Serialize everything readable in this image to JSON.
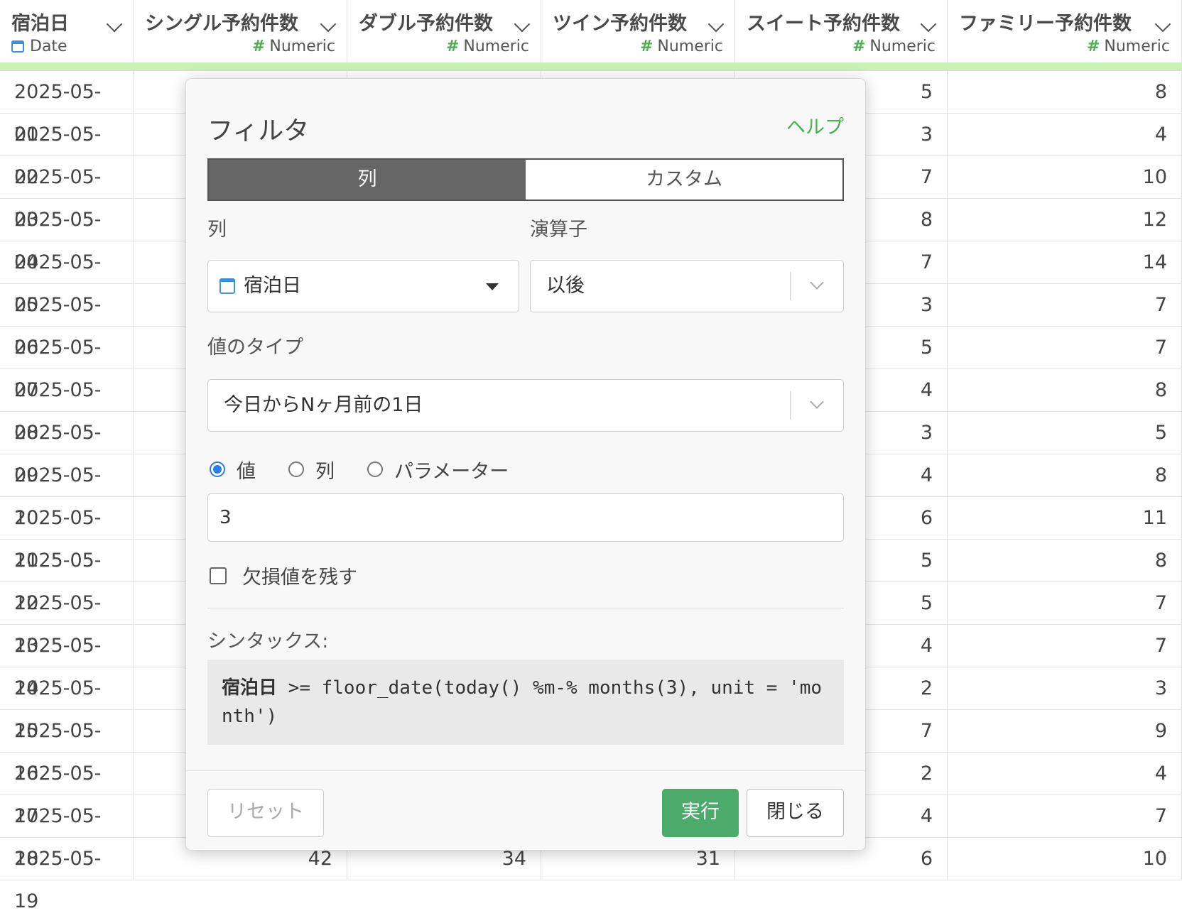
{
  "columns": [
    {
      "name": "宿泊日",
      "type": "Date",
      "type_icon": "calendar-icon"
    },
    {
      "name": "シングル予約件数",
      "type": "Numeric",
      "type_icon": "#"
    },
    {
      "name": "ダブル予約件数",
      "type": "Numeric",
      "type_icon": "#"
    },
    {
      "name": "ツイン予約件数",
      "type": "Numeric",
      "type_icon": "#"
    },
    {
      "name": "スイート予約件数",
      "type": "Numeric",
      "type_icon": "#"
    },
    {
      "name": "ファミリー予約件数",
      "type": "Numeric",
      "type_icon": "#"
    }
  ],
  "rows": [
    {
      "date": "2025-05-01",
      "single": "",
      "double": "",
      "twin": "",
      "suite": "5",
      "family": "8"
    },
    {
      "date": "2025-05-02",
      "single": "",
      "double": "",
      "twin": "",
      "suite": "3",
      "family": "4"
    },
    {
      "date": "2025-05-03",
      "single": "",
      "double": "",
      "twin": "",
      "suite": "7",
      "family": "10"
    },
    {
      "date": "2025-05-04",
      "single": "",
      "double": "",
      "twin": "",
      "suite": "8",
      "family": "12"
    },
    {
      "date": "2025-05-05",
      "single": "",
      "double": "",
      "twin": "",
      "suite": "7",
      "family": "14"
    },
    {
      "date": "2025-05-06",
      "single": "",
      "double": "",
      "twin": "",
      "suite": "3",
      "family": "7"
    },
    {
      "date": "2025-05-07",
      "single": "",
      "double": "",
      "twin": "",
      "suite": "5",
      "family": "7"
    },
    {
      "date": "2025-05-08",
      "single": "",
      "double": "",
      "twin": "",
      "suite": "4",
      "family": "8"
    },
    {
      "date": "2025-05-09",
      "single": "",
      "double": "",
      "twin": "",
      "suite": "3",
      "family": "5"
    },
    {
      "date": "2025-05-10",
      "single": "",
      "double": "",
      "twin": "",
      "suite": "4",
      "family": "8"
    },
    {
      "date": "2025-05-11",
      "single": "",
      "double": "",
      "twin": "",
      "suite": "6",
      "family": "11"
    },
    {
      "date": "2025-05-12",
      "single": "",
      "double": "",
      "twin": "",
      "suite": "5",
      "family": "8"
    },
    {
      "date": "2025-05-13",
      "single": "",
      "double": "",
      "twin": "",
      "suite": "5",
      "family": "7"
    },
    {
      "date": "2025-05-14",
      "single": "",
      "double": "",
      "twin": "",
      "suite": "4",
      "family": "7"
    },
    {
      "date": "2025-05-15",
      "single": "",
      "double": "",
      "twin": "",
      "suite": "2",
      "family": "3"
    },
    {
      "date": "2025-05-16",
      "single": "",
      "double": "",
      "twin": "",
      "suite": "7",
      "family": "9"
    },
    {
      "date": "2025-05-17",
      "single": "",
      "double": "",
      "twin": "",
      "suite": "2",
      "family": "4"
    },
    {
      "date": "2025-05-18",
      "single": "",
      "double": "",
      "twin": "",
      "suite": "4",
      "family": "7"
    },
    {
      "date": "2025-05-19",
      "single": "42",
      "double": "34",
      "twin": "31",
      "suite": "6",
      "family": "10"
    }
  ],
  "filter": {
    "title": "フィルタ",
    "help": "ヘルプ",
    "tabs": {
      "column": "列",
      "custom": "カスタム"
    },
    "column_label": "列",
    "column_value": "宿泊日",
    "operator_label": "演算子",
    "operator_value": "以後",
    "value_type_label": "値のタイプ",
    "value_type_value": "今日からNヶ月前の1日",
    "radio": {
      "value": "値",
      "column": "列",
      "parameter": "パラメーター",
      "selected": "value"
    },
    "input_value": "3",
    "keep_na_label": "欠損値を残す",
    "syntax_label": "シンタックス:",
    "syntax_column": "宿泊日",
    "syntax_expr": " >= floor_date(today() %m-% months(3), unit = 'month')",
    "buttons": {
      "reset": "リセット",
      "run": "実行",
      "close": "閉じる"
    },
    "accent_color": "#4caa6b"
  }
}
